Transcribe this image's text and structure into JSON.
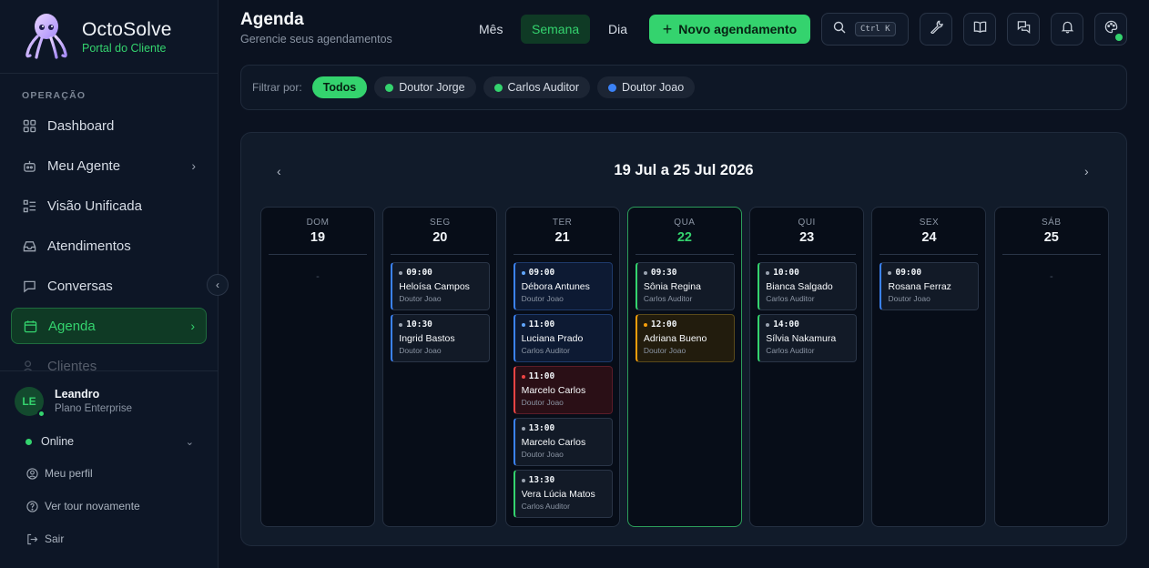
{
  "brand": {
    "name": "OctoSolve",
    "subtitle": "Portal do Cliente"
  },
  "sidebar": {
    "section_label": "OPERAÇÃO",
    "items": [
      {
        "label": "Dashboard",
        "icon": "dashboard-icon"
      },
      {
        "label": "Meu Agente",
        "icon": "bot-icon"
      },
      {
        "label": "Visão Unificada",
        "icon": "list-icon"
      },
      {
        "label": "Atendimentos",
        "icon": "inbox-icon"
      },
      {
        "label": "Conversas",
        "icon": "message-icon"
      },
      {
        "label": "Agenda",
        "icon": "calendar-icon",
        "active": true
      },
      {
        "label": "Clientes",
        "icon": "users-icon"
      }
    ],
    "user": {
      "initials": "LE",
      "name": "Leandro",
      "plan": "Plano Enterprise",
      "status": "Online"
    },
    "links": [
      {
        "label": "Meu perfil",
        "icon": "user-circle-icon"
      },
      {
        "label": "Ver tour novamente",
        "icon": "help-icon"
      },
      {
        "label": "Sair",
        "icon": "logout-icon"
      }
    ]
  },
  "header": {
    "title": "Agenda",
    "subtitle": "Gerencie seus agendamentos",
    "views": [
      {
        "label": "Mês"
      },
      {
        "label": "Semana",
        "active": true
      },
      {
        "label": "Dia"
      }
    ],
    "new_button": "Novo agendamento",
    "search_shortcut": "Ctrl K"
  },
  "filters": {
    "label": "Filtrar por:",
    "chips": [
      {
        "label": "Todos",
        "active": true
      },
      {
        "label": "Doutor Jorge",
        "color": "#34d36e"
      },
      {
        "label": "Carlos Auditor",
        "color": "#34d36e"
      },
      {
        "label": "Doutor Joao",
        "color": "#3b82f6"
      }
    ]
  },
  "calendar": {
    "range": "19 Jul a 25 Jul 2026",
    "prev": "‹",
    "next": "›",
    "days": [
      {
        "name": "DOM",
        "num": "19",
        "empty": "-",
        "appts": []
      },
      {
        "name": "SEG",
        "num": "20",
        "appts": [
          {
            "time": "09:00",
            "name": "Heloísa Campos",
            "doctor": "Doutor Joao",
            "style": "blue"
          },
          {
            "time": "10:30",
            "name": "Ingrid Bastos",
            "doctor": "Doutor Joao",
            "style": "blue"
          }
        ]
      },
      {
        "name": "TER",
        "num": "21",
        "appts": [
          {
            "time": "09:00",
            "name": "Débora Antunes",
            "doctor": "Doutor Joao",
            "style": "blue-bg",
            "dot": "#60a5fa"
          },
          {
            "time": "11:00",
            "name": "Luciana Prado",
            "doctor": "Carlos Auditor",
            "style": "blue-bg",
            "dot": "#60a5fa"
          },
          {
            "time": "11:00",
            "name": "Marcelo Carlos",
            "doctor": "Doutor Joao",
            "style": "red",
            "dot": "#ef4444"
          },
          {
            "time": "13:00",
            "name": "Marcelo Carlos",
            "doctor": "Doutor Joao",
            "style": "blue"
          },
          {
            "time": "13:30",
            "name": "Vera Lúcia Matos",
            "doctor": "Carlos Auditor",
            "style": "green"
          }
        ]
      },
      {
        "name": "QUA",
        "num": "22",
        "today": true,
        "appts": [
          {
            "time": "09:30",
            "name": "Sônia Regina",
            "doctor": "Carlos Auditor",
            "style": "green"
          },
          {
            "time": "12:00",
            "name": "Adriana Bueno",
            "doctor": "Doutor Joao",
            "style": "amber",
            "dot": "#f59e0b"
          }
        ]
      },
      {
        "name": "QUI",
        "num": "23",
        "appts": [
          {
            "time": "10:00",
            "name": "Bianca Salgado",
            "doctor": "Carlos Auditor",
            "style": "green"
          },
          {
            "time": "14:00",
            "name": "Sílvia Nakamura",
            "doctor": "Carlos Auditor",
            "style": "green"
          }
        ]
      },
      {
        "name": "SEX",
        "num": "24",
        "appts": [
          {
            "time": "09:00",
            "name": "Rosana Ferraz",
            "doctor": "Doutor Joao",
            "style": "blue"
          }
        ]
      },
      {
        "name": "SÁB",
        "num": "25",
        "empty": "-",
        "appts": []
      }
    ]
  },
  "colors": {
    "accent": "#34d36e",
    "blue": "#3b82f6",
    "red": "#ef4444",
    "amber": "#f59e0b"
  }
}
